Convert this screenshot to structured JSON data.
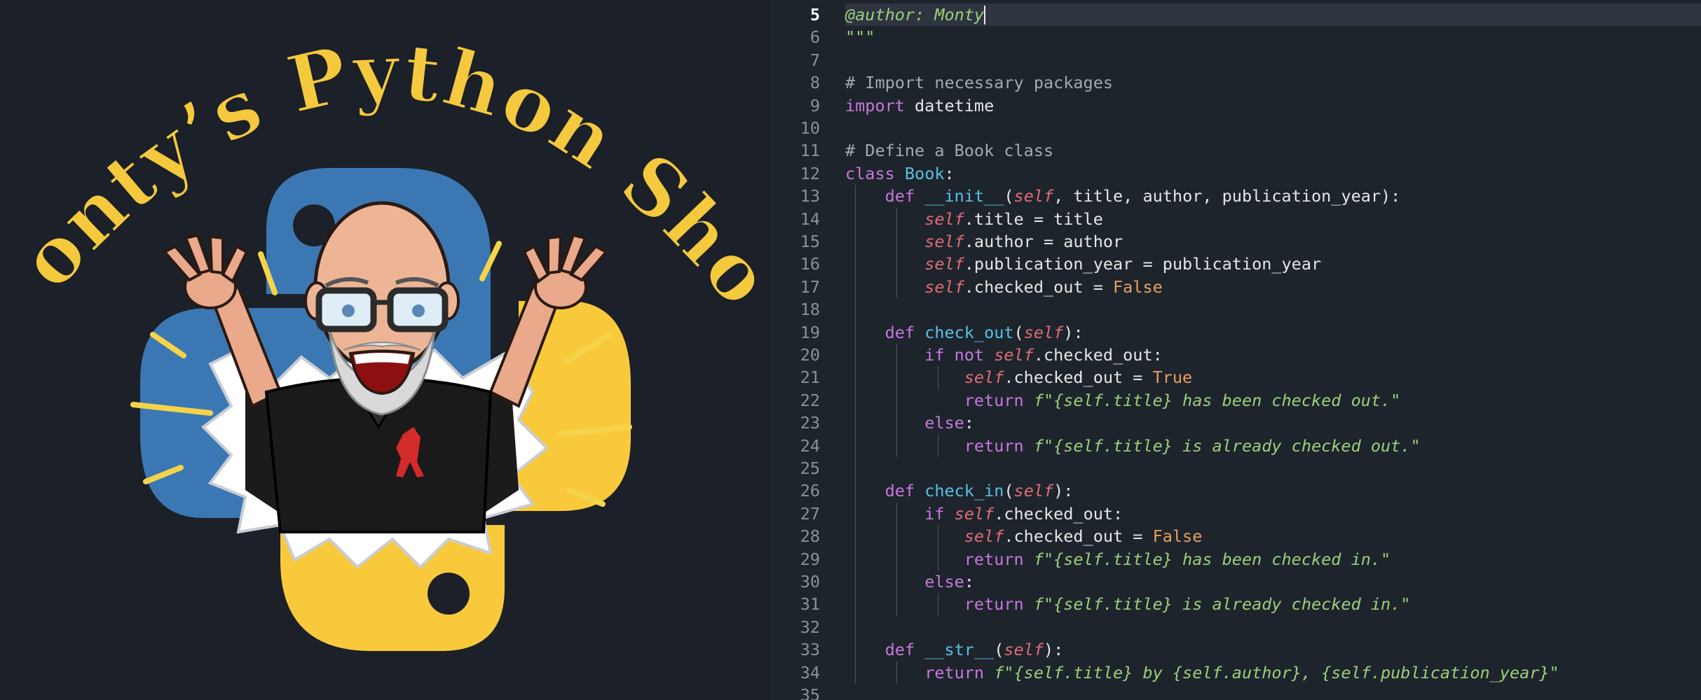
{
  "logo": {
    "title": "Monty’s Python Show",
    "polo_icon": "polo-horse-icon",
    "colors": {
      "title": "#f5c93d",
      "python_blue": "#3b78b3",
      "python_yellow": "#f9c93c",
      "background": "#1b2029"
    }
  },
  "editor": {
    "active_line": "5",
    "line_numbers": [
      "5",
      "6",
      "7",
      "8",
      "9",
      "10",
      "11",
      "12",
      "13",
      "14",
      "15",
      "16",
      "17",
      "18",
      "19",
      "20",
      "21",
      "22",
      "23",
      "24",
      "25",
      "26",
      "27",
      "28",
      "29",
      "30",
      "31",
      "32",
      "33",
      "34",
      "35"
    ],
    "colors": {
      "keyword": "#c678dd",
      "function": "#56c1e3",
      "self": "#e06c75",
      "string": "#9bcf7b",
      "constant": "#e5a060",
      "comment": "#a4a9b0"
    },
    "lines": [
      [
        {
          "t": "@author: Monty",
          "c": "doc"
        }
      ],
      [
        {
          "t": "\"\"\"",
          "c": "doc"
        }
      ],
      [],
      [
        {
          "t": "# Import necessary packages",
          "c": "cmt"
        }
      ],
      [
        {
          "t": "import",
          "c": "kw"
        },
        {
          "t": " datetime",
          "c": "plain"
        }
      ],
      [],
      [
        {
          "t": "# Define a Book class",
          "c": "cmt"
        }
      ],
      [
        {
          "t": "class",
          "c": "kw"
        },
        {
          "t": " ",
          "c": "plain"
        },
        {
          "t": "Book",
          "c": "cls"
        },
        {
          "t": ":",
          "c": "plain"
        }
      ],
      [
        {
          "t": "    ",
          "c": "plain"
        },
        {
          "t": "def",
          "c": "kw"
        },
        {
          "t": " ",
          "c": "plain"
        },
        {
          "t": "__init__",
          "c": "fn"
        },
        {
          "t": "(",
          "c": "plain"
        },
        {
          "t": "self",
          "c": "self"
        },
        {
          "t": ", title, author, publication_year):",
          "c": "plain"
        }
      ],
      [
        {
          "t": "        ",
          "c": "plain"
        },
        {
          "t": "self",
          "c": "self"
        },
        {
          "t": ".title = title",
          "c": "plain"
        }
      ],
      [
        {
          "t": "        ",
          "c": "plain"
        },
        {
          "t": "self",
          "c": "self"
        },
        {
          "t": ".author = author",
          "c": "plain"
        }
      ],
      [
        {
          "t": "        ",
          "c": "plain"
        },
        {
          "t": "self",
          "c": "self"
        },
        {
          "t": ".publication_year = publication_year",
          "c": "plain"
        }
      ],
      [
        {
          "t": "        ",
          "c": "plain"
        },
        {
          "t": "self",
          "c": "self"
        },
        {
          "t": ".checked_out = ",
          "c": "plain"
        },
        {
          "t": "False",
          "c": "const"
        }
      ],
      [],
      [
        {
          "t": "    ",
          "c": "plain"
        },
        {
          "t": "def",
          "c": "kw"
        },
        {
          "t": " ",
          "c": "plain"
        },
        {
          "t": "check_out",
          "c": "fn"
        },
        {
          "t": "(",
          "c": "plain"
        },
        {
          "t": "self",
          "c": "self"
        },
        {
          "t": "):",
          "c": "plain"
        }
      ],
      [
        {
          "t": "        ",
          "c": "plain"
        },
        {
          "t": "if not",
          "c": "kw"
        },
        {
          "t": " ",
          "c": "plain"
        },
        {
          "t": "self",
          "c": "self"
        },
        {
          "t": ".checked_out:",
          "c": "plain"
        }
      ],
      [
        {
          "t": "            ",
          "c": "plain"
        },
        {
          "t": "self",
          "c": "self"
        },
        {
          "t": ".checked_out = ",
          "c": "plain"
        },
        {
          "t": "True",
          "c": "const"
        }
      ],
      [
        {
          "t": "            ",
          "c": "plain"
        },
        {
          "t": "return",
          "c": "kw"
        },
        {
          "t": " ",
          "c": "plain"
        },
        {
          "t": "f\"{self.title} has been checked out.\"",
          "c": "str"
        }
      ],
      [
        {
          "t": "        ",
          "c": "plain"
        },
        {
          "t": "else",
          "c": "kw"
        },
        {
          "t": ":",
          "c": "plain"
        }
      ],
      [
        {
          "t": "            ",
          "c": "plain"
        },
        {
          "t": "return",
          "c": "kw"
        },
        {
          "t": " ",
          "c": "plain"
        },
        {
          "t": "f\"{self.title} is already checked out.\"",
          "c": "str"
        }
      ],
      [],
      [
        {
          "t": "    ",
          "c": "plain"
        },
        {
          "t": "def",
          "c": "kw"
        },
        {
          "t": " ",
          "c": "plain"
        },
        {
          "t": "check_in",
          "c": "fn"
        },
        {
          "t": "(",
          "c": "plain"
        },
        {
          "t": "self",
          "c": "self"
        },
        {
          "t": "):",
          "c": "plain"
        }
      ],
      [
        {
          "t": "        ",
          "c": "plain"
        },
        {
          "t": "if",
          "c": "kw"
        },
        {
          "t": " ",
          "c": "plain"
        },
        {
          "t": "self",
          "c": "self"
        },
        {
          "t": ".checked_out:",
          "c": "plain"
        }
      ],
      [
        {
          "t": "            ",
          "c": "plain"
        },
        {
          "t": "self",
          "c": "self"
        },
        {
          "t": ".checked_out = ",
          "c": "plain"
        },
        {
          "t": "False",
          "c": "const"
        }
      ],
      [
        {
          "t": "            ",
          "c": "plain"
        },
        {
          "t": "return",
          "c": "kw"
        },
        {
          "t": " ",
          "c": "plain"
        },
        {
          "t": "f\"{self.title} has been checked in.\"",
          "c": "str"
        }
      ],
      [
        {
          "t": "        ",
          "c": "plain"
        },
        {
          "t": "else",
          "c": "kw"
        },
        {
          "t": ":",
          "c": "plain"
        }
      ],
      [
        {
          "t": "            ",
          "c": "plain"
        },
        {
          "t": "return",
          "c": "kw"
        },
        {
          "t": " ",
          "c": "plain"
        },
        {
          "t": "f\"{self.title} is already checked in.\"",
          "c": "str"
        }
      ],
      [],
      [
        {
          "t": "    ",
          "c": "plain"
        },
        {
          "t": "def",
          "c": "kw"
        },
        {
          "t": " ",
          "c": "plain"
        },
        {
          "t": "__str__",
          "c": "fn"
        },
        {
          "t": "(",
          "c": "plain"
        },
        {
          "t": "self",
          "c": "self"
        },
        {
          "t": "):",
          "c": "plain"
        }
      ],
      [
        {
          "t": "        ",
          "c": "plain"
        },
        {
          "t": "return",
          "c": "kw"
        },
        {
          "t": " ",
          "c": "plain"
        },
        {
          "t": "f\"{self.title} by {self.author}, {self.publication_year}\"",
          "c": "str"
        }
      ],
      []
    ]
  }
}
